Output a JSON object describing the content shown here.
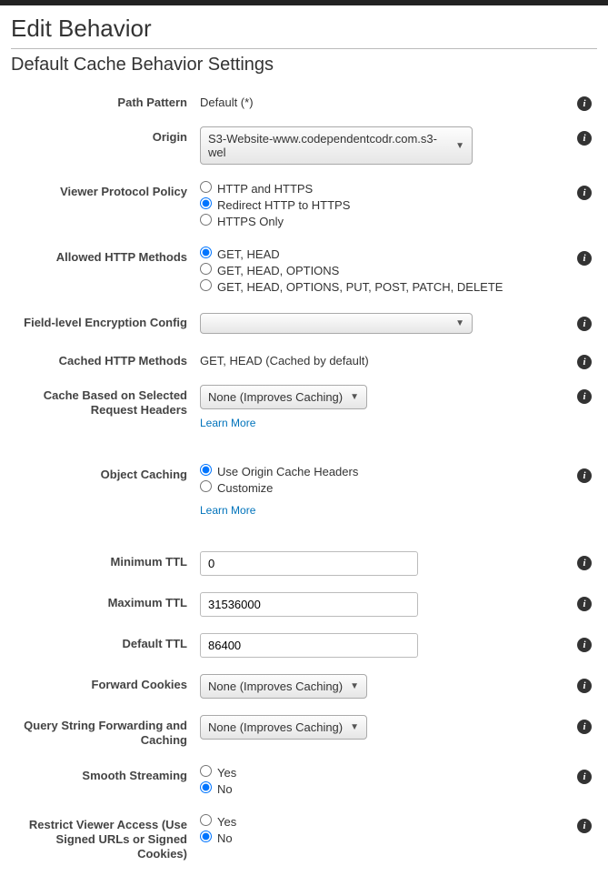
{
  "page": {
    "title": "Edit Behavior",
    "section": "Default Cache Behavior Settings"
  },
  "labels": {
    "path_pattern": "Path Pattern",
    "origin": "Origin",
    "viewer_protocol": "Viewer Protocol Policy",
    "allowed_methods": "Allowed HTTP Methods",
    "field_encryption": "Field-level Encryption Config",
    "cached_methods": "Cached HTTP Methods",
    "cache_headers": "Cache Based on Selected Request Headers",
    "object_caching": "Object Caching",
    "min_ttl": "Minimum TTL",
    "max_ttl": "Maximum TTL",
    "default_ttl": "Default TTL",
    "forward_cookies": "Forward Cookies",
    "query_string": "Query String Forwarding and Caching",
    "smooth_streaming": "Smooth Streaming",
    "restrict_viewer": "Restrict Viewer Access (Use Signed URLs or Signed Cookies)"
  },
  "values": {
    "path_pattern": "Default (*)",
    "origin_selected": "S3-Website-www.codependentcodr.com.s3-wel",
    "cached_methods": "GET, HEAD (Cached by default)",
    "cache_headers_selected": "None (Improves Caching)",
    "min_ttl": "0",
    "max_ttl": "31536000",
    "default_ttl": "86400",
    "forward_cookies_selected": "None (Improves Caching)",
    "query_string_selected": "None (Improves Caching)",
    "field_encryption_selected": ""
  },
  "radios": {
    "viewer_protocol": {
      "opt1": "HTTP and HTTPS",
      "opt2": "Redirect HTTP to HTTPS",
      "opt3": "HTTPS Only"
    },
    "allowed_methods": {
      "opt1": "GET, HEAD",
      "opt2": "GET, HEAD, OPTIONS",
      "opt3": "GET, HEAD, OPTIONS, PUT, POST, PATCH, DELETE"
    },
    "object_caching": {
      "opt1": "Use Origin Cache Headers",
      "opt2": "Customize"
    },
    "yesno": {
      "yes": "Yes",
      "no": "No"
    }
  },
  "links": {
    "learn_more": "Learn More"
  }
}
